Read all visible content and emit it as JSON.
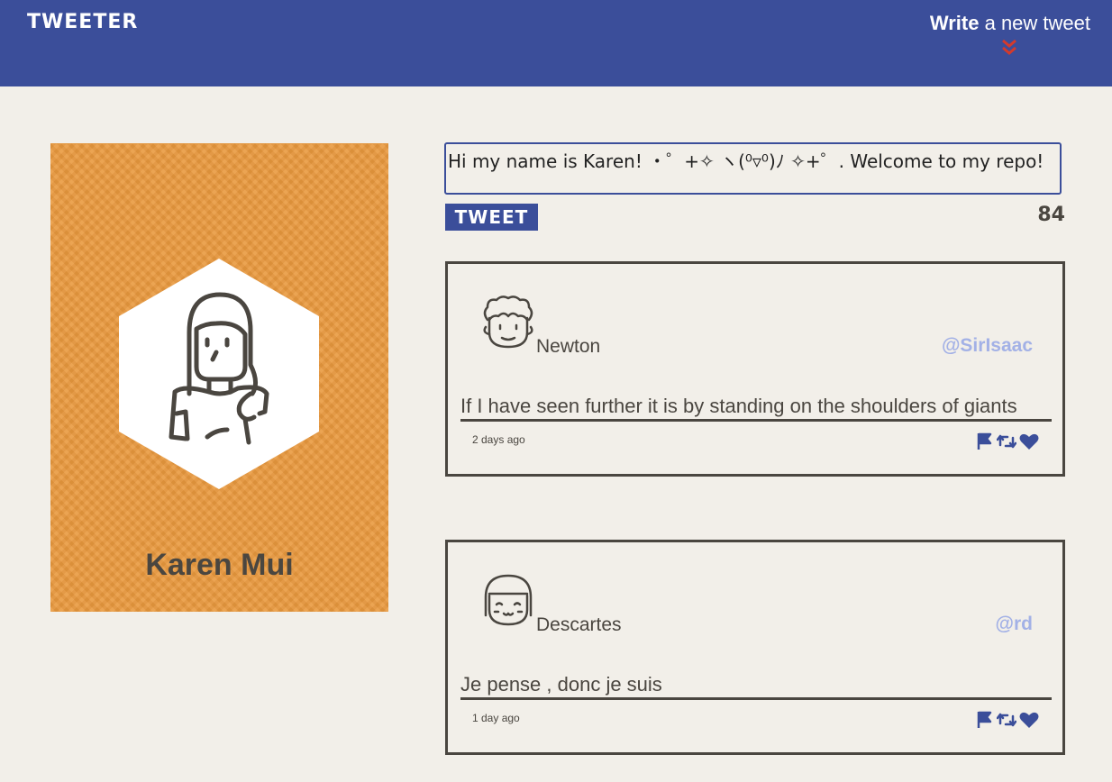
{
  "header": {
    "brand": "TWEETER",
    "compose_bold": "Write",
    "compose_rest": " a new tweet",
    "accent_color": "#3b4e9a",
    "chevron_color": "#d33a2c"
  },
  "profile": {
    "name": "Karen Mui",
    "card_color": "#e9993e"
  },
  "composer": {
    "value": "Hi my name is Karen! ・゜+✧ ヽ(⁰▿⁰)ﾉ ✧+゜. Welcome to my repo!",
    "button_label": "TWEET",
    "char_count": "84"
  },
  "tweets": [
    {
      "author": "Newton",
      "handle": "@SirIsaac",
      "text": "If I have seen further it is by standing on the shoulders of giants",
      "time": "2 days ago",
      "avatar": "curly-hair-man-avatar"
    },
    {
      "author": "Descartes",
      "handle": "@rd",
      "text": "Je pense , donc je suis",
      "time": "1 day ago",
      "avatar": "bob-hair-girl-avatar"
    }
  ]
}
